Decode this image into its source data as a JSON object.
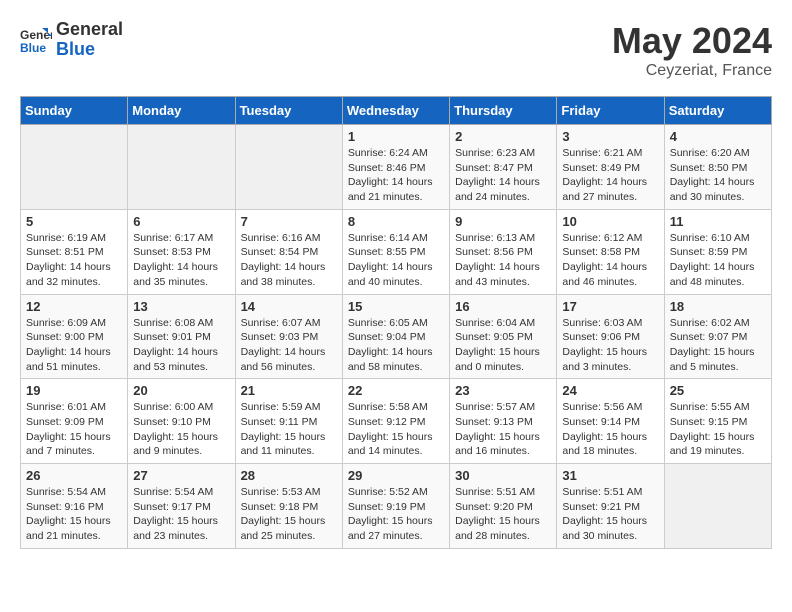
{
  "header": {
    "logo_general": "General",
    "logo_blue": "Blue",
    "month_year": "May 2024",
    "location": "Ceyzeriat, France"
  },
  "days_of_week": [
    "Sunday",
    "Monday",
    "Tuesday",
    "Wednesday",
    "Thursday",
    "Friday",
    "Saturday"
  ],
  "weeks": [
    [
      {
        "day": "",
        "info": ""
      },
      {
        "day": "",
        "info": ""
      },
      {
        "day": "",
        "info": ""
      },
      {
        "day": "1",
        "info": "Sunrise: 6:24 AM\nSunset: 8:46 PM\nDaylight: 14 hours\nand 21 minutes."
      },
      {
        "day": "2",
        "info": "Sunrise: 6:23 AM\nSunset: 8:47 PM\nDaylight: 14 hours\nand 24 minutes."
      },
      {
        "day": "3",
        "info": "Sunrise: 6:21 AM\nSunset: 8:49 PM\nDaylight: 14 hours\nand 27 minutes."
      },
      {
        "day": "4",
        "info": "Sunrise: 6:20 AM\nSunset: 8:50 PM\nDaylight: 14 hours\nand 30 minutes."
      }
    ],
    [
      {
        "day": "5",
        "info": "Sunrise: 6:19 AM\nSunset: 8:51 PM\nDaylight: 14 hours\nand 32 minutes."
      },
      {
        "day": "6",
        "info": "Sunrise: 6:17 AM\nSunset: 8:53 PM\nDaylight: 14 hours\nand 35 minutes."
      },
      {
        "day": "7",
        "info": "Sunrise: 6:16 AM\nSunset: 8:54 PM\nDaylight: 14 hours\nand 38 minutes."
      },
      {
        "day": "8",
        "info": "Sunrise: 6:14 AM\nSunset: 8:55 PM\nDaylight: 14 hours\nand 40 minutes."
      },
      {
        "day": "9",
        "info": "Sunrise: 6:13 AM\nSunset: 8:56 PM\nDaylight: 14 hours\nand 43 minutes."
      },
      {
        "day": "10",
        "info": "Sunrise: 6:12 AM\nSunset: 8:58 PM\nDaylight: 14 hours\nand 46 minutes."
      },
      {
        "day": "11",
        "info": "Sunrise: 6:10 AM\nSunset: 8:59 PM\nDaylight: 14 hours\nand 48 minutes."
      }
    ],
    [
      {
        "day": "12",
        "info": "Sunrise: 6:09 AM\nSunset: 9:00 PM\nDaylight: 14 hours\nand 51 minutes."
      },
      {
        "day": "13",
        "info": "Sunrise: 6:08 AM\nSunset: 9:01 PM\nDaylight: 14 hours\nand 53 minutes."
      },
      {
        "day": "14",
        "info": "Sunrise: 6:07 AM\nSunset: 9:03 PM\nDaylight: 14 hours\nand 56 minutes."
      },
      {
        "day": "15",
        "info": "Sunrise: 6:05 AM\nSunset: 9:04 PM\nDaylight: 14 hours\nand 58 minutes."
      },
      {
        "day": "16",
        "info": "Sunrise: 6:04 AM\nSunset: 9:05 PM\nDaylight: 15 hours\nand 0 minutes."
      },
      {
        "day": "17",
        "info": "Sunrise: 6:03 AM\nSunset: 9:06 PM\nDaylight: 15 hours\nand 3 minutes."
      },
      {
        "day": "18",
        "info": "Sunrise: 6:02 AM\nSunset: 9:07 PM\nDaylight: 15 hours\nand 5 minutes."
      }
    ],
    [
      {
        "day": "19",
        "info": "Sunrise: 6:01 AM\nSunset: 9:09 PM\nDaylight: 15 hours\nand 7 minutes."
      },
      {
        "day": "20",
        "info": "Sunrise: 6:00 AM\nSunset: 9:10 PM\nDaylight: 15 hours\nand 9 minutes."
      },
      {
        "day": "21",
        "info": "Sunrise: 5:59 AM\nSunset: 9:11 PM\nDaylight: 15 hours\nand 11 minutes."
      },
      {
        "day": "22",
        "info": "Sunrise: 5:58 AM\nSunset: 9:12 PM\nDaylight: 15 hours\nand 14 minutes."
      },
      {
        "day": "23",
        "info": "Sunrise: 5:57 AM\nSunset: 9:13 PM\nDaylight: 15 hours\nand 16 minutes."
      },
      {
        "day": "24",
        "info": "Sunrise: 5:56 AM\nSunset: 9:14 PM\nDaylight: 15 hours\nand 18 minutes."
      },
      {
        "day": "25",
        "info": "Sunrise: 5:55 AM\nSunset: 9:15 PM\nDaylight: 15 hours\nand 19 minutes."
      }
    ],
    [
      {
        "day": "26",
        "info": "Sunrise: 5:54 AM\nSunset: 9:16 PM\nDaylight: 15 hours\nand 21 minutes."
      },
      {
        "day": "27",
        "info": "Sunrise: 5:54 AM\nSunset: 9:17 PM\nDaylight: 15 hours\nand 23 minutes."
      },
      {
        "day": "28",
        "info": "Sunrise: 5:53 AM\nSunset: 9:18 PM\nDaylight: 15 hours\nand 25 minutes."
      },
      {
        "day": "29",
        "info": "Sunrise: 5:52 AM\nSunset: 9:19 PM\nDaylight: 15 hours\nand 27 minutes."
      },
      {
        "day": "30",
        "info": "Sunrise: 5:51 AM\nSunset: 9:20 PM\nDaylight: 15 hours\nand 28 minutes."
      },
      {
        "day": "31",
        "info": "Sunrise: 5:51 AM\nSunset: 9:21 PM\nDaylight: 15 hours\nand 30 minutes."
      },
      {
        "day": "",
        "info": ""
      }
    ]
  ]
}
